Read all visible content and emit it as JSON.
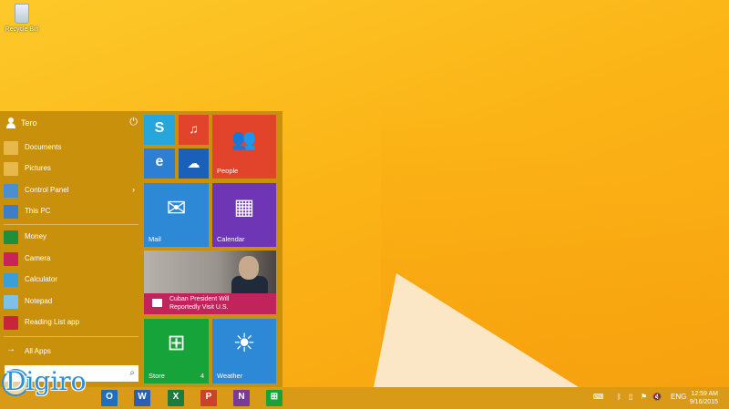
{
  "desktop": {
    "recycle_label": "Recycle Bin"
  },
  "start": {
    "user": "Tero",
    "items": [
      {
        "label": "Documents",
        "icon": "folder-icon",
        "color": "#e8b84a"
      },
      {
        "label": "Pictures",
        "icon": "folder-icon",
        "color": "#e8b84a"
      },
      {
        "label": "Control Panel",
        "icon": "control-panel-icon",
        "color": "#4a8fd0",
        "arrow": "›"
      },
      {
        "label": "This PC",
        "icon": "computer-icon",
        "color": "#3a7fc8"
      }
    ],
    "apps": [
      {
        "label": "Money",
        "icon": "money-icon",
        "color": "#1e8f3a"
      },
      {
        "label": "Camera",
        "icon": "camera-icon",
        "color": "#c8245a"
      },
      {
        "label": "Calculator",
        "icon": "calculator-icon",
        "color": "#3a9ed8"
      },
      {
        "label": "Notepad",
        "icon": "notepad-icon",
        "color": "#7fc0e8"
      },
      {
        "label": "Reading List app",
        "icon": "reading-list-icon",
        "color": "#c8243a"
      }
    ],
    "all_apps": "All Apps",
    "search_placeholder": ""
  },
  "tiles": {
    "people": "People",
    "mail": "Mail",
    "calendar": "Calendar",
    "news_headline_1": "Cuban President Will",
    "news_headline_2": "Reportedly Visit U.S.",
    "store": "Store",
    "store_badge": "4",
    "weather": "Weather"
  },
  "taskbar": {
    "language": "ENG",
    "time": "12:59 AM",
    "date": "9/16/2015"
  },
  "watermark": "Digiro"
}
